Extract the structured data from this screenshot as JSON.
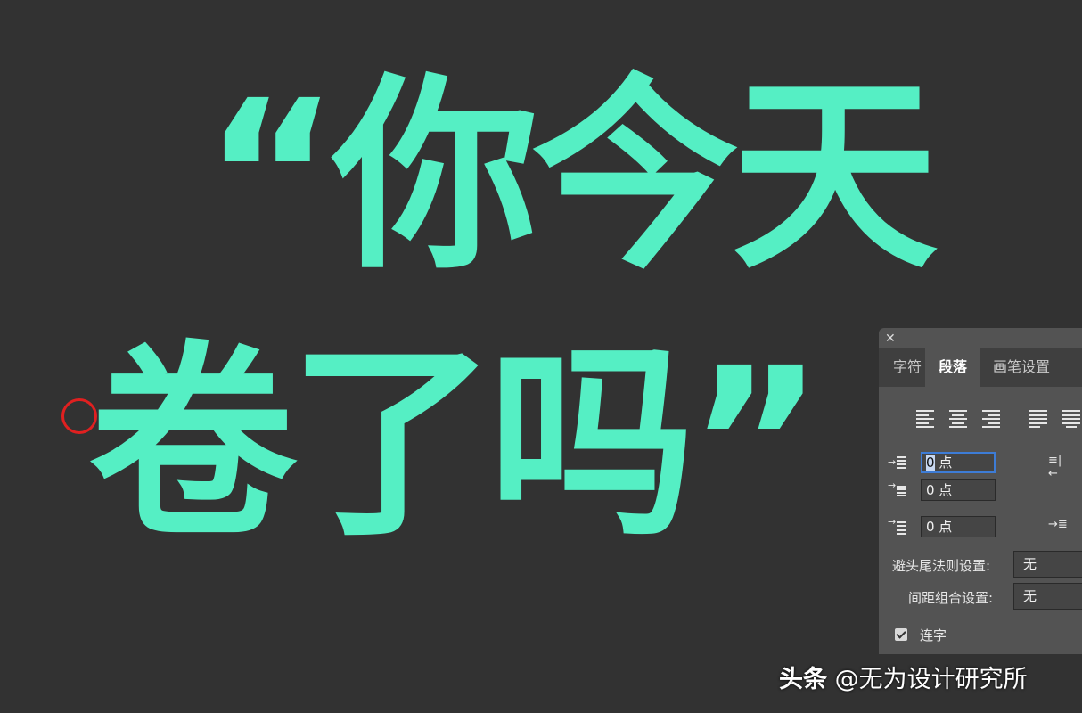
{
  "canvas": {
    "headline_line1": "“你今天",
    "headline_line2": "卷了吗”",
    "text_color": "#55efc4",
    "background_color": "#323232"
  },
  "panel": {
    "close_icon": "close-icon",
    "tabs": [
      {
        "label": "字符",
        "active": false
      },
      {
        "label": "段落",
        "active": true
      },
      {
        "label": "画笔设置",
        "active": false
      }
    ],
    "alignment": {
      "options": [
        "align-left",
        "align-center",
        "align-right",
        "justify-last-left",
        "justify-last-center"
      ],
      "selected": "align-center",
      "highlight_color": "#e02020"
    },
    "indent_left": {
      "value": "0",
      "unit": "点"
    },
    "indent_first_line": {
      "value": "0 点"
    },
    "space_before": {
      "value": "0 点"
    },
    "kinsoku_label": "避头尾法则设置:",
    "kinsoku_value": "无",
    "mojikumi_label": "间距组合设置:",
    "mojikumi_value": "无",
    "hyphenate_label": "连字",
    "hyphenate_checked": true
  },
  "watermark": {
    "brand": "头条",
    "handle": "@无为设计研究所"
  }
}
